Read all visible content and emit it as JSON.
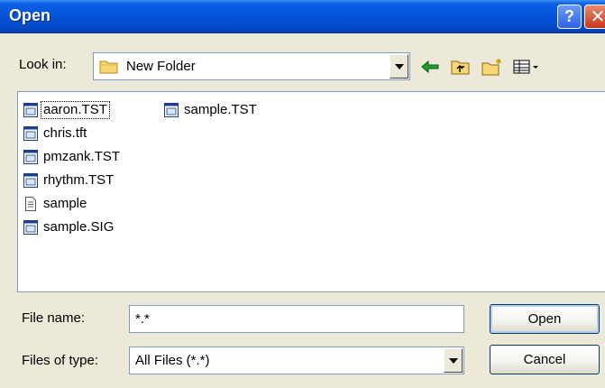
{
  "window": {
    "title": "Open"
  },
  "toolbar": {
    "look_in_label": "Look in:",
    "look_in_value": "New Folder",
    "icons": [
      "back-arrow-icon",
      "up-folder-icon",
      "new-folder-icon",
      "view-menu-icon"
    ]
  },
  "files": [
    {
      "name": "aaron.TST",
      "icon": "app-file-icon",
      "selected": true
    },
    {
      "name": "chris.tft",
      "icon": "app-file-icon"
    },
    {
      "name": "pmzank.TST",
      "icon": "app-file-icon"
    },
    {
      "name": "rhythm.TST",
      "icon": "app-file-icon"
    },
    {
      "name": "sample",
      "icon": "text-file-icon"
    },
    {
      "name": "sample.SIG",
      "icon": "app-file-icon"
    },
    {
      "name": "sample.TST",
      "icon": "app-file-icon"
    }
  ],
  "form": {
    "file_name_label": "File name:",
    "file_name_value": "*.*",
    "files_of_type_label": "Files of type:",
    "files_of_type_value": "All Files (*.*)"
  },
  "buttons": {
    "open": "Open",
    "cancel": "Cancel"
  },
  "colors": {
    "titlebar": "#0553D8",
    "face": "#ECE9D8",
    "close": "#C9361A"
  }
}
